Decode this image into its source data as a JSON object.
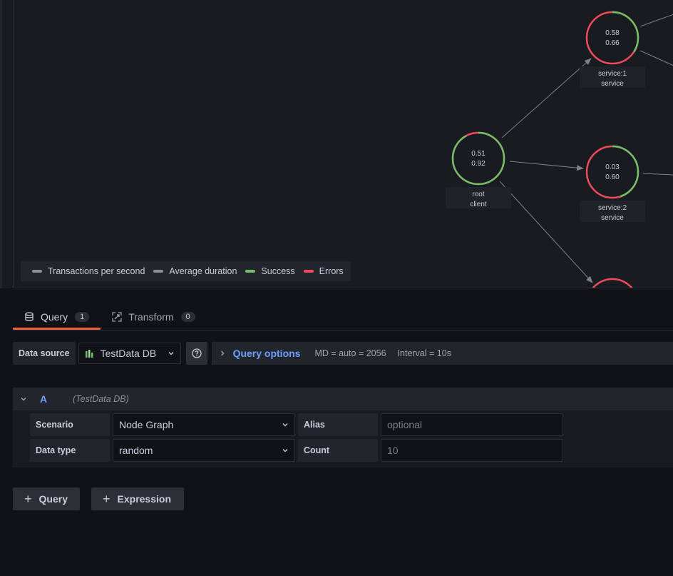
{
  "graph": {
    "nodes": [
      {
        "id": "root",
        "title": "root",
        "subtitle": "client",
        "stat1": "0.51",
        "stat2": "0.92",
        "success": 0.92
      },
      {
        "id": "service1",
        "title": "service:1",
        "subtitle": "service",
        "stat1": "0.58",
        "stat2": "0.66",
        "success": 0.34
      },
      {
        "id": "service2",
        "title": "service:2",
        "subtitle": "service",
        "stat1": "0.03",
        "stat2": "0.60",
        "success": 0.45
      }
    ],
    "legend": [
      {
        "label": "Transactions per second",
        "color": "#8e8e8e"
      },
      {
        "label": "Average duration",
        "color": "#8e8e8e"
      },
      {
        "label": "Success",
        "color": "#73bf69"
      },
      {
        "label": "Errors",
        "color": "#f2495c"
      }
    ],
    "colors": {
      "success": "#73bf69",
      "error": "#f2495c",
      "edge": "#7f8285"
    }
  },
  "tabs": [
    {
      "label": "Query",
      "count": "1",
      "icon": "database-icon"
    },
    {
      "label": "Transform",
      "count": "0",
      "icon": "transform-icon"
    }
  ],
  "datasource": {
    "label": "Data source",
    "name": "TestData DB",
    "query_options": "Query options",
    "md": "MD = auto = 2056",
    "interval": "Interval = 10s"
  },
  "query": {
    "letter": "A",
    "datasource": "(TestData DB)",
    "scenario_label": "Scenario",
    "scenario_value": "Node Graph",
    "alias_label": "Alias",
    "alias_placeholder": "optional",
    "datatype_label": "Data type",
    "datatype_value": "random",
    "count_label": "Count",
    "count_value": "10"
  },
  "buttons": {
    "add_query": "Query",
    "add_expression": "Expression"
  }
}
